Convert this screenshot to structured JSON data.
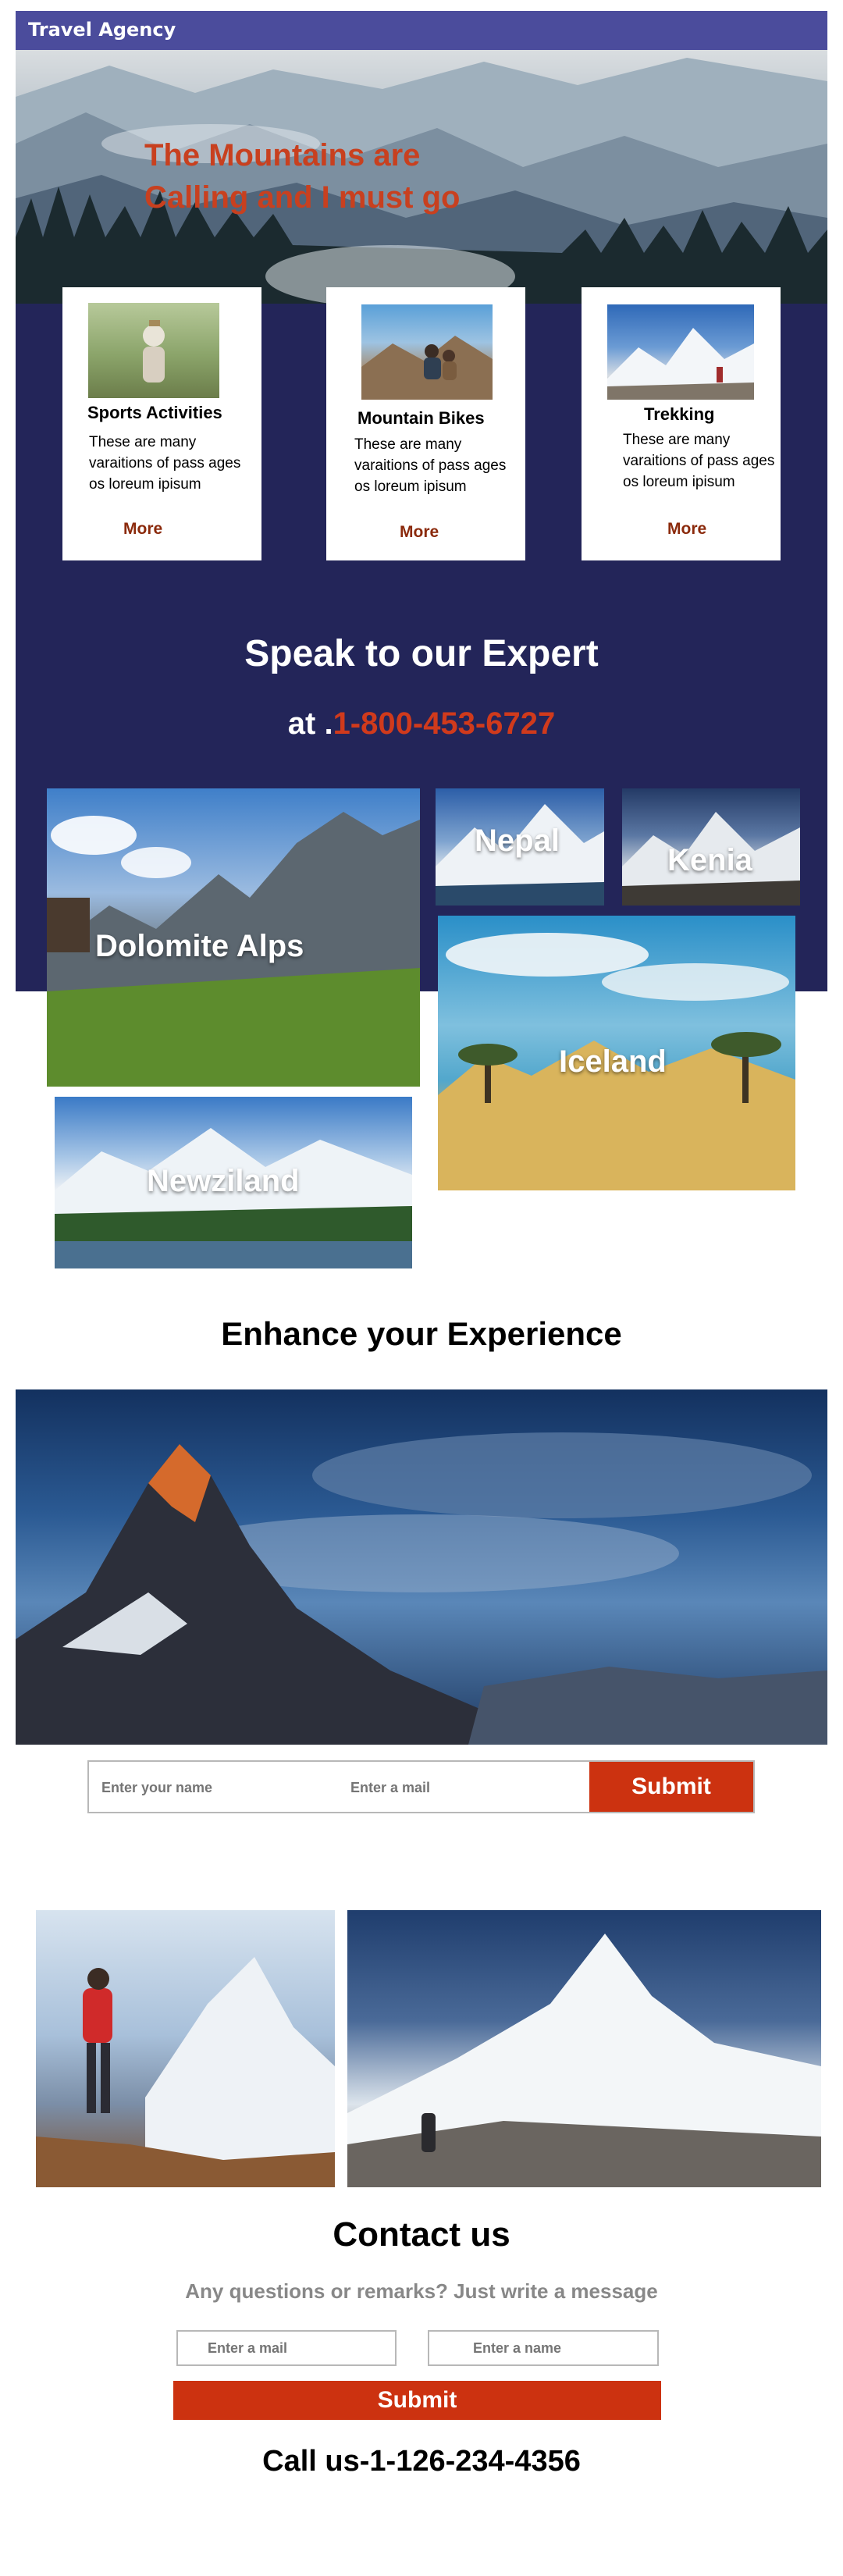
{
  "header": {
    "brand": "Travel Agency"
  },
  "hero": {
    "title": "The Mountains are\nCalling and I must go"
  },
  "cards": [
    {
      "title": "Sports Activities",
      "desc": "These are many varaitions of  pass ages os loreum ipisum",
      "more": "More"
    },
    {
      "title": "Mountain Bikes",
      "desc": "These are many varaitions of  pass ages os loreum ipisum",
      "more": "More"
    },
    {
      "title": "Trekking",
      "desc": "These are many varaitions of  pass ages os loreum ipisum",
      "more": "More"
    }
  ],
  "expert": {
    "heading": "Speak to our Expert",
    "prefix": "at .",
    "phone": "1-800-453-6727"
  },
  "destinations": [
    "Dolomite Alps",
    "Nepal",
    "Kenia",
    "Iceland",
    "Newziland"
  ],
  "enhance": {
    "heading": "Enhance your Experience"
  },
  "subscribe": {
    "name_placeholder": "Enter your name",
    "mail_placeholder": "Enter a mail",
    "submit": "Submit"
  },
  "contact": {
    "heading": "Contact us",
    "subheading": "Any questions or remarks? Just write a message",
    "mail_placeholder": "Enter a mail",
    "name_placeholder": "Enter a name",
    "submit": "Submit",
    "call": "Call us-1-126-234-4356"
  },
  "colors": {
    "nav": "#4b4c9c",
    "band": "#232559",
    "accent": "#cc3210"
  }
}
